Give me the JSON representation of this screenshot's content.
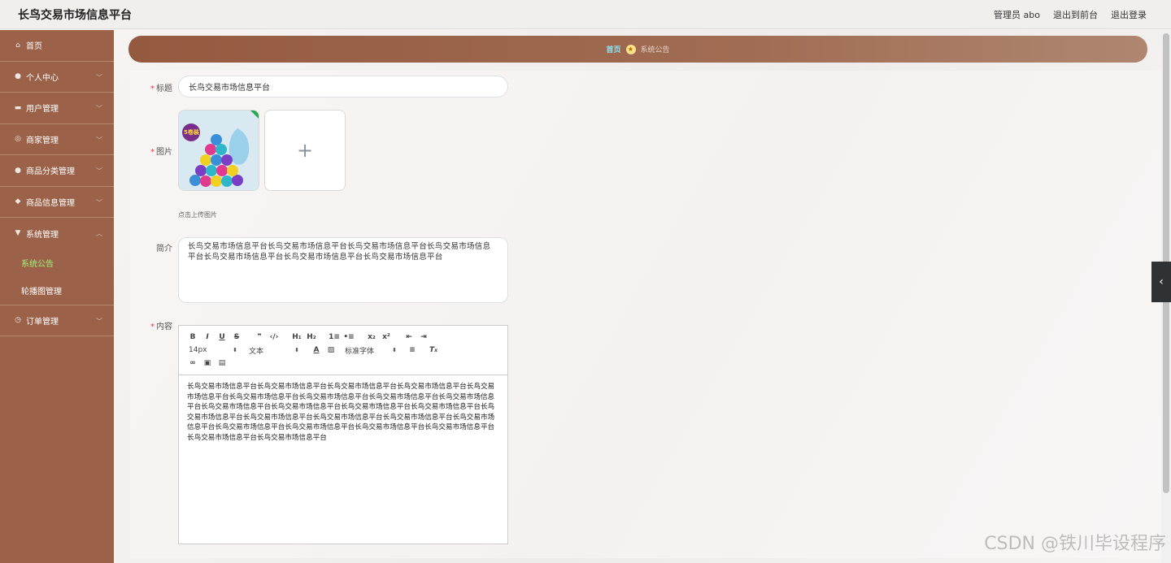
{
  "header": {
    "app_title": "长鸟交易市场信息平台",
    "admin_label": "管理员 abo",
    "back_front_label": "退出到前台",
    "logout_label": "退出登录"
  },
  "sidebar": {
    "items": [
      {
        "label": "首页",
        "icon": "home-icon"
      },
      {
        "label": "个人中心",
        "icon": "user-icon"
      },
      {
        "label": "用户管理",
        "icon": "users-icon"
      },
      {
        "label": "商家管理",
        "icon": "shop-icon"
      },
      {
        "label": "商品分类管理",
        "icon": "category-icon"
      },
      {
        "label": "商品信息管理",
        "icon": "goods-icon"
      },
      {
        "label": "系统管理",
        "icon": "settings-icon"
      },
      {
        "label": "订单管理",
        "icon": "order-icon"
      }
    ],
    "submenu": [
      {
        "label": "系统公告",
        "active": true
      },
      {
        "label": "轮播图管理",
        "active": false
      }
    ],
    "active_color": "#9ef07e",
    "bg_color": "#9c6249"
  },
  "breadcrumb": {
    "home": "首页",
    "current": "系统公告"
  },
  "form": {
    "title_label": "标题",
    "title_value": "长鸟交易市场信息平台",
    "image_label": "图片",
    "upload_hint": "点击上传图片",
    "intro_label": "简介",
    "intro_value": "长鸟交易市场信息平台长鸟交易市场信息平台长鸟交易市场信息平台长鸟交易市场信息平台长鸟交易市场信息平台长鸟交易市场信息平台长鸟交易市场信息平台",
    "content_label": "内容",
    "content_value": "长鸟交易市场信息平台长鸟交易市场信息平台长鸟交易市场信息平台长鸟交易市场信息平台长鸟交易市场信息平台长鸟交易市场信息平台长鸟交易市场信息平台长鸟交易市场信息平台长鸟交易市场信息平台长鸟交易市场信息平台长鸟交易市场信息平台长鸟交易市场信息平台长鸟交易市场信息平台长鸟交易市场信息平台长鸟交易市场信息平台长鸟交易市场信息平台长鸟交易市场信息平台长鸟交易市场信息平台长鸟交易市场信息平台长鸟交易市场信息平台长鸟交易市场信息平台长鸟交易市场信息平台长鸟交易市场信息平台长鸟交易市场信息平台"
  },
  "editor": {
    "font_size": "14px",
    "block_format": "文本",
    "font_family": "标准字体",
    "buttons_row1": [
      "B",
      "I",
      "U",
      "S",
      "❞",
      "‹/›",
      "H₁",
      "H₂",
      "1≡",
      "•≡",
      "x₂",
      "x²",
      "⇤",
      "⇥"
    ],
    "image_badge": "5卷装"
  },
  "watermark": "CSDN @铁川毕设程序"
}
